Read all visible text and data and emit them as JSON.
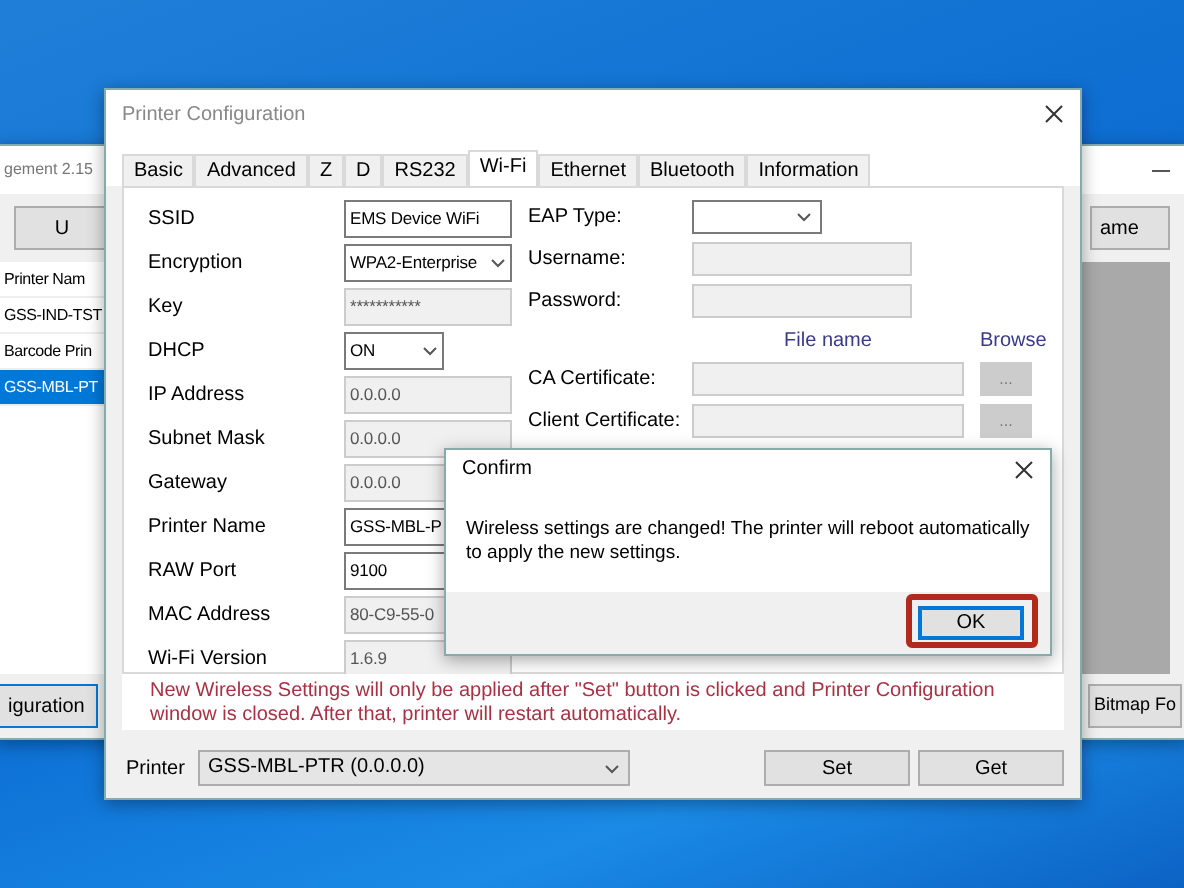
{
  "background_window": {
    "title": "gement 2.15",
    "left_button": "U",
    "right_button": "ame",
    "list_header": "Printer Nam",
    "rows": [
      {
        "name": "GSS-IND-TST",
        "selected": false
      },
      {
        "name": "Barcode Prin",
        "selected": false
      },
      {
        "name": "GSS-MBL-PT",
        "selected": true
      }
    ],
    "bottom_left_button": "iguration",
    "bottom_right_button": "Bitmap Fo"
  },
  "dialog": {
    "title": "Printer Configuration",
    "tabs": [
      {
        "label": "Basic",
        "selected": false
      },
      {
        "label": "Advanced",
        "selected": false
      },
      {
        "label": "Z",
        "selected": false
      },
      {
        "label": "D",
        "selected": false
      },
      {
        "label": "RS232",
        "selected": false
      },
      {
        "label": "Wi-Fi",
        "selected": true
      },
      {
        "label": "Ethernet",
        "selected": false
      },
      {
        "label": "Bluetooth",
        "selected": false
      },
      {
        "label": "Information",
        "selected": false
      }
    ],
    "left_fields": [
      {
        "label": "SSID",
        "value": "EMS Device WiFi",
        "kind": "text",
        "disabled": false
      },
      {
        "label": "Encryption",
        "value": "WPA2-Enterprise",
        "kind": "select",
        "disabled": false
      },
      {
        "label": "Key",
        "value": "***********",
        "kind": "text",
        "disabled": true
      },
      {
        "label": "DHCP",
        "value": "ON",
        "kind": "select",
        "disabled": false
      },
      {
        "label": "IP Address",
        "value": "0.0.0.0",
        "kind": "text",
        "disabled": true
      },
      {
        "label": "Subnet Mask",
        "value": "0.0.0.0",
        "kind": "text",
        "disabled": true
      },
      {
        "label": "Gateway",
        "value": "0.0.0.0",
        "kind": "text",
        "disabled": true
      },
      {
        "label": "Printer Name",
        "value": "GSS-MBL-P",
        "kind": "text",
        "disabled": false
      },
      {
        "label": "RAW Port",
        "value": "9100",
        "kind": "text",
        "disabled": false
      },
      {
        "label": "MAC Address",
        "value": "80-C9-55-0",
        "kind": "text",
        "disabled": true
      },
      {
        "label": "Wi-Fi Version",
        "value": "1.6.9",
        "kind": "text",
        "disabled": true
      }
    ],
    "right_fields": [
      {
        "label": "EAP Type:",
        "kind": "select",
        "disabled": false
      },
      {
        "label": "Username:",
        "kind": "text",
        "disabled": true
      },
      {
        "label": "Password:",
        "kind": "text",
        "disabled": true
      }
    ],
    "file_header": "File name",
    "browse_header": "Browse",
    "certificates": [
      {
        "label": "CA Certificate:",
        "button": "..."
      },
      {
        "label": "Client Certificate:",
        "button": "..."
      }
    ],
    "note": "New Wireless Settings will only be applied after \"Set\" button is clicked and Printer Configuration window is closed. After that, printer will restart automatically.",
    "printer_label": "Printer",
    "printer_value": "GSS-MBL-PTR (0.0.0.0)",
    "buttons": [
      "Set",
      "Get"
    ]
  },
  "confirm": {
    "title": "Confirm",
    "message": "Wireless settings are changed! The printer will reboot automatically to apply the new settings.",
    "ok": "OK",
    "highlighted": true
  }
}
